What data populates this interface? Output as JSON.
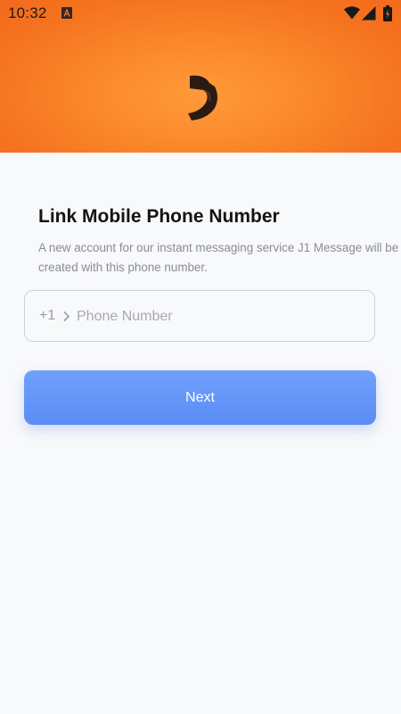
{
  "status_bar": {
    "time": "10:32",
    "icons": [
      "notification-a-icon",
      "wifi-icon",
      "cell-signal-icon",
      "battery-icon"
    ]
  },
  "header": {
    "logo": "app-logo-icon",
    "colors": {
      "gradient_center": "#ff9a3a",
      "gradient_edge": "#f26a1c",
      "logo_color": "#2a1a12"
    }
  },
  "main": {
    "title": "Link Mobile Phone Number",
    "description": "A new account for our instant messaging service J1 Message will be created with this phone number.",
    "phone": {
      "country_code": "+1",
      "placeholder": "Phone Number",
      "value": ""
    },
    "next_label": "Next"
  },
  "colors": {
    "background": "#f8f9fb",
    "button": "#5b8cf6",
    "title_text": "#141414",
    "secondary_text": "#8a8c92"
  }
}
